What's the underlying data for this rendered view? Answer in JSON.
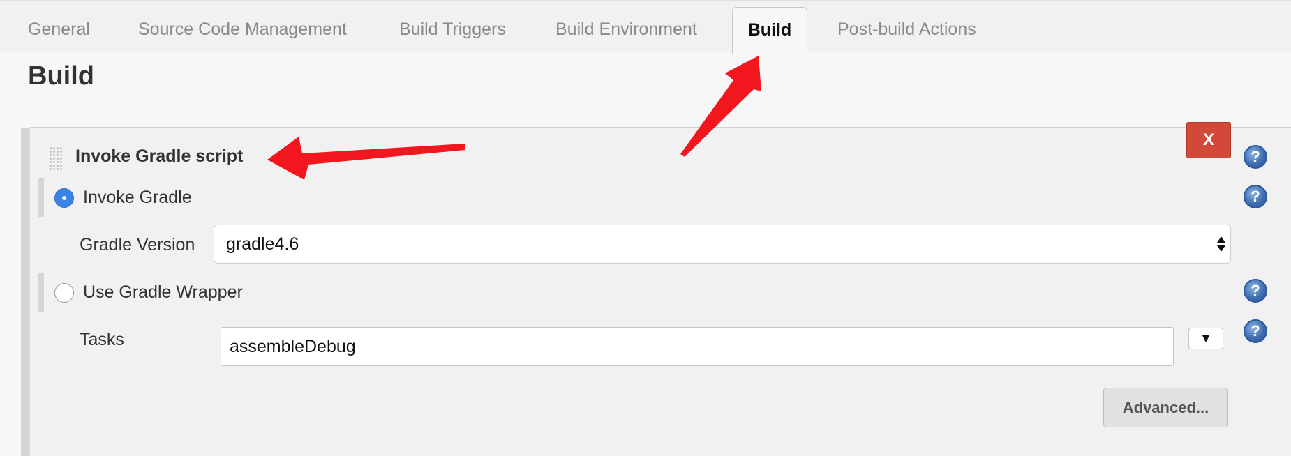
{
  "tabs": [
    {
      "label": "General"
    },
    {
      "label": "Source Code Management"
    },
    {
      "label": "Build Triggers"
    },
    {
      "label": "Build Environment"
    },
    {
      "label": "Build",
      "active": true
    },
    {
      "label": "Post-build Actions"
    }
  ],
  "section": {
    "title": "Build"
  },
  "step": {
    "title": "Invoke Gradle script",
    "delete_label": "X",
    "help_icon_glyph": "?",
    "options": [
      {
        "label": "Invoke Gradle",
        "selected": true
      },
      {
        "label": "Use Gradle Wrapper",
        "selected": false
      }
    ],
    "gradle_version": {
      "label": "Gradle Version",
      "value": "gradle4.6"
    },
    "tasks": {
      "label": "Tasks",
      "value": "assembleDebug",
      "dropdown_glyph": "▼"
    },
    "advanced_label": "Advanced..."
  },
  "colors": {
    "accent_blue": "#3b84e6",
    "delete_red": "#d24939",
    "annotation_red": "#f2161f"
  },
  "icons": [
    "drag-handle-icon",
    "help-icon",
    "close-icon",
    "chevron-down-icon"
  ]
}
